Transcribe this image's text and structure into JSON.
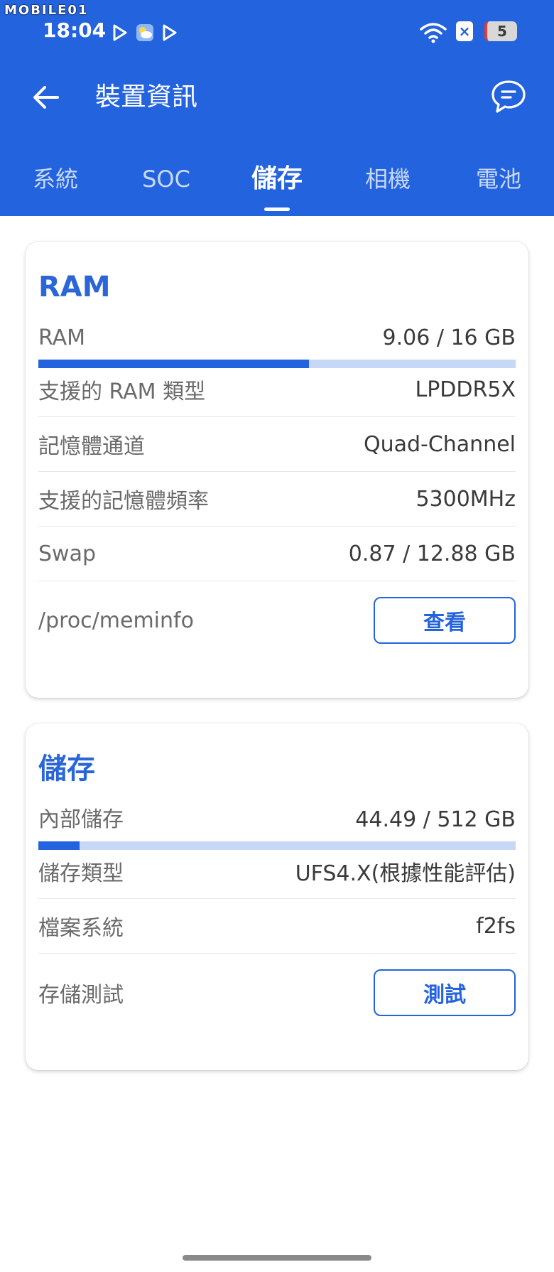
{
  "watermark": "MOBILE01",
  "status_bar": {
    "time": "18:04",
    "battery": "5",
    "x_badge": "×"
  },
  "toolbar": {
    "title": "裝置資訊",
    "back_icon": "arrow-left-icon",
    "chat_icon": "chat-bubble-icon"
  },
  "tabs": [
    {
      "label": "系統"
    },
    {
      "label": "SOC"
    },
    {
      "label": "儲存"
    },
    {
      "label": "相機"
    },
    {
      "label": "電池"
    }
  ],
  "active_tab": "儲存",
  "ram_card": {
    "title": "RAM",
    "usage": {
      "label": "RAM",
      "value": "9.06 / 16 GB",
      "used": 9.06,
      "total": 16
    },
    "rows": [
      {
        "label": "支援的 RAM 類型",
        "value": "LPDDR5X"
      },
      {
        "label": "記憶體通道",
        "value": "Quad-Channel"
      },
      {
        "label": "支援的記憶體頻率",
        "value": "5300MHz"
      },
      {
        "label": "Swap",
        "value": "0.87 / 12.88 GB"
      }
    ],
    "action": {
      "label": "/proc/meminfo",
      "button": "查看"
    }
  },
  "storage_card": {
    "title": "儲存",
    "usage": {
      "label": "內部儲存",
      "value": "44.49 / 512 GB",
      "used": 44.49,
      "total": 512
    },
    "rows": [
      {
        "label": "儲存類型",
        "value": "UFS4.X(根據性能評估)"
      },
      {
        "label": "檔案系統",
        "value": "f2fs"
      }
    ],
    "action": {
      "label": "存儲測試",
      "button": "測試"
    }
  },
  "colors": {
    "primary": "#2463de",
    "bar_track": "#c7d8f7",
    "card_title": "#2a66d8"
  }
}
